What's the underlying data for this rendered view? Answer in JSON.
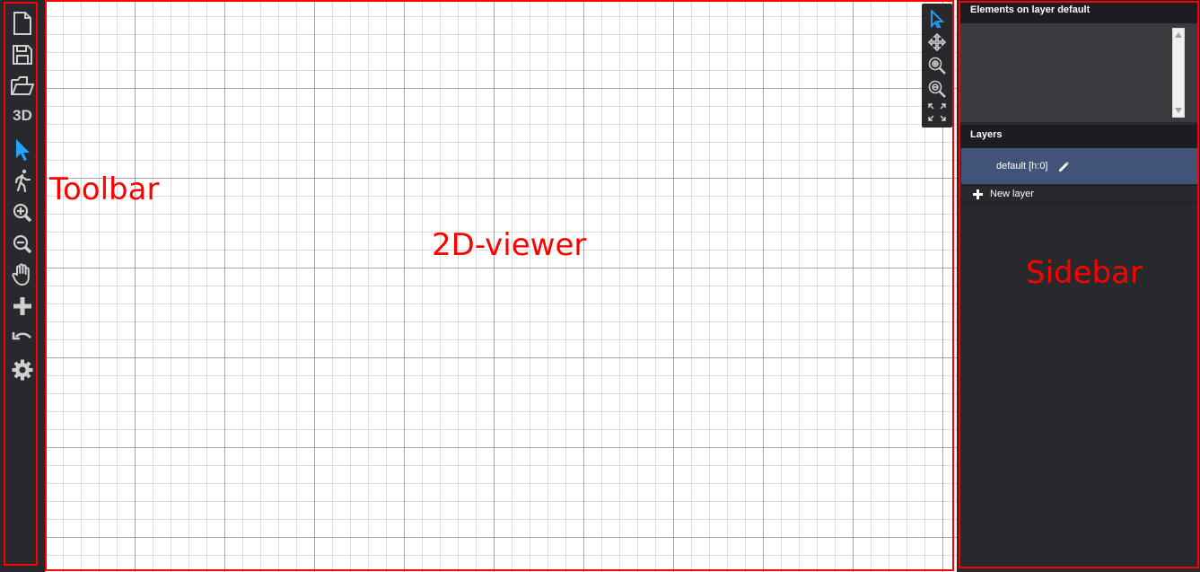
{
  "toolbar": {
    "buttons": [
      {
        "name": "new-file-icon"
      },
      {
        "name": "save-icon"
      },
      {
        "name": "open-folder-icon"
      },
      {
        "name": "view-3d-button",
        "label": "3D"
      },
      {
        "name": "select-pointer-icon",
        "active": true
      },
      {
        "name": "walk-icon"
      },
      {
        "name": "zoom-in-icon"
      },
      {
        "name": "zoom-out-icon"
      },
      {
        "name": "pan-hand-icon"
      },
      {
        "name": "add-icon"
      },
      {
        "name": "undo-icon"
      },
      {
        "name": "settings-gear-icon"
      }
    ]
  },
  "viewer_controls": [
    {
      "name": "pointer-icon",
      "active": true
    },
    {
      "name": "pan-move-icon"
    },
    {
      "name": "zoom-in-icon"
    },
    {
      "name": "zoom-out-icon"
    },
    {
      "name": "fit-screen-icon"
    }
  ],
  "sidebar": {
    "elements_title": "Elements on layer default",
    "layers_title": "Layers",
    "layers": [
      {
        "label": "default [h:0]",
        "selected": true
      }
    ],
    "new_layer_label": "New layer"
  },
  "annotations": {
    "toolbar": "Toolbar",
    "viewer": "2D-viewer",
    "sidebar": "Sidebar"
  },
  "colors": {
    "accent": "#1ea7fd",
    "panel": "#28292d",
    "selected_layer": "#415377",
    "annotation": "#ff0000"
  }
}
